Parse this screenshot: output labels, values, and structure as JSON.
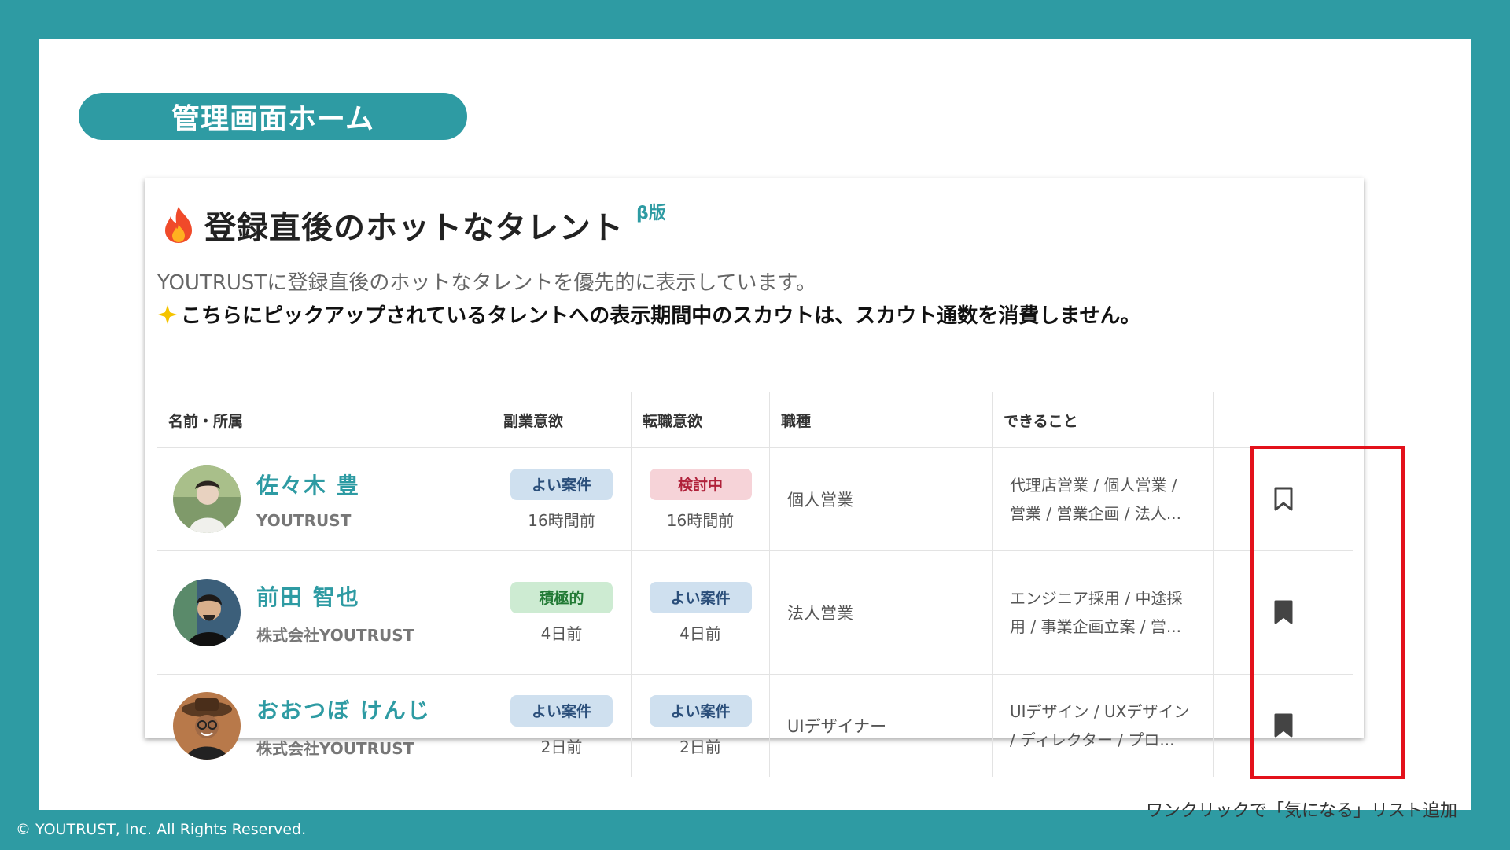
{
  "slide_title": "管理画面ホーム",
  "card": {
    "title": "登録直後のホットなタレント",
    "beta": "β版",
    "description": "YOUTRUSTに登録直後のホットなタレントを優先的に表示しています。",
    "note": "こちらにピックアップされているタレントへの表示期間中のスカウトは、スカウト通数を消費しません。"
  },
  "table": {
    "headers": [
      "名前・所属",
      "副業意欲",
      "転職意欲",
      "職種",
      "できること",
      ""
    ],
    "rows": [
      {
        "name": "佐々木 豊",
        "company": "YOUTRUST",
        "side_job": {
          "label": "よい案件",
          "time": "16時間前",
          "color": "blue"
        },
        "job_change": {
          "label": "検討中",
          "time": "16時間前",
          "color": "red"
        },
        "job_type": "個人営業",
        "skills_line1": "代理店営業 / 個人営業 /",
        "skills_line2": "営業 / 営業企画 / 法人...",
        "bookmark": "bookmark-outline-icon"
      },
      {
        "name": "前田 智也",
        "company": "株式会社YOUTRUST",
        "side_job": {
          "label": "積極的",
          "time": "4日前",
          "color": "green"
        },
        "job_change": {
          "label": "よい案件",
          "time": "4日前",
          "color": "blue"
        },
        "job_type": "法人営業",
        "skills_line1": "エンジニア採用 / 中途採",
        "skills_line2": "用 / 事業企画立案 / 営...",
        "bookmark": "bookmark-filled-icon"
      },
      {
        "name": "おおつぼ けんじ",
        "company": "株式会社YOUTRUST",
        "side_job": {
          "label": "よい案件",
          "time": "2日前",
          "color": "blue"
        },
        "job_change": {
          "label": "よい案件",
          "time": "2日前",
          "color": "blue"
        },
        "job_type": "UIデザイナー",
        "skills_line1": "UIデザイン / UXデザイン",
        "skills_line2": "/ ディレクター / プロ...",
        "bookmark": "bookmark-filled-icon"
      }
    ]
  },
  "caption": "ワンクリックで「気になる」リスト追加",
  "footer": "© YOUTRUST, Inc. All Rights Reserved.",
  "colors": {
    "accent": "#2e9ba3",
    "highlight": "#e3111b"
  }
}
